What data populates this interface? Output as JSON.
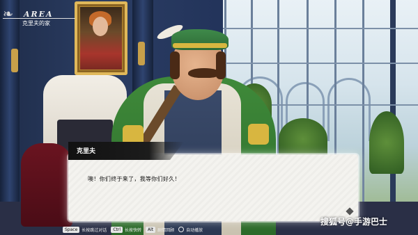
{
  "area": {
    "label": "AREA",
    "location": "克里夫的家"
  },
  "dialog": {
    "speaker": "克里夫",
    "line": "噢！你们终于来了，我等你们好久！"
  },
  "controls": [
    {
      "key": "Space",
      "label": "长按跳过对话"
    },
    {
      "key": "Ctrl",
      "label": "长按快转"
    },
    {
      "key": "Alt",
      "label": "剧情回顾"
    },
    {
      "key": "",
      "label": "自动播放"
    }
  ],
  "watermark": "搜狐号@手游巴士",
  "colors": {
    "dialog_bg": "#f4f3ef",
    "nameplate_bg": "#111111",
    "wall": "#2b3d63"
  }
}
